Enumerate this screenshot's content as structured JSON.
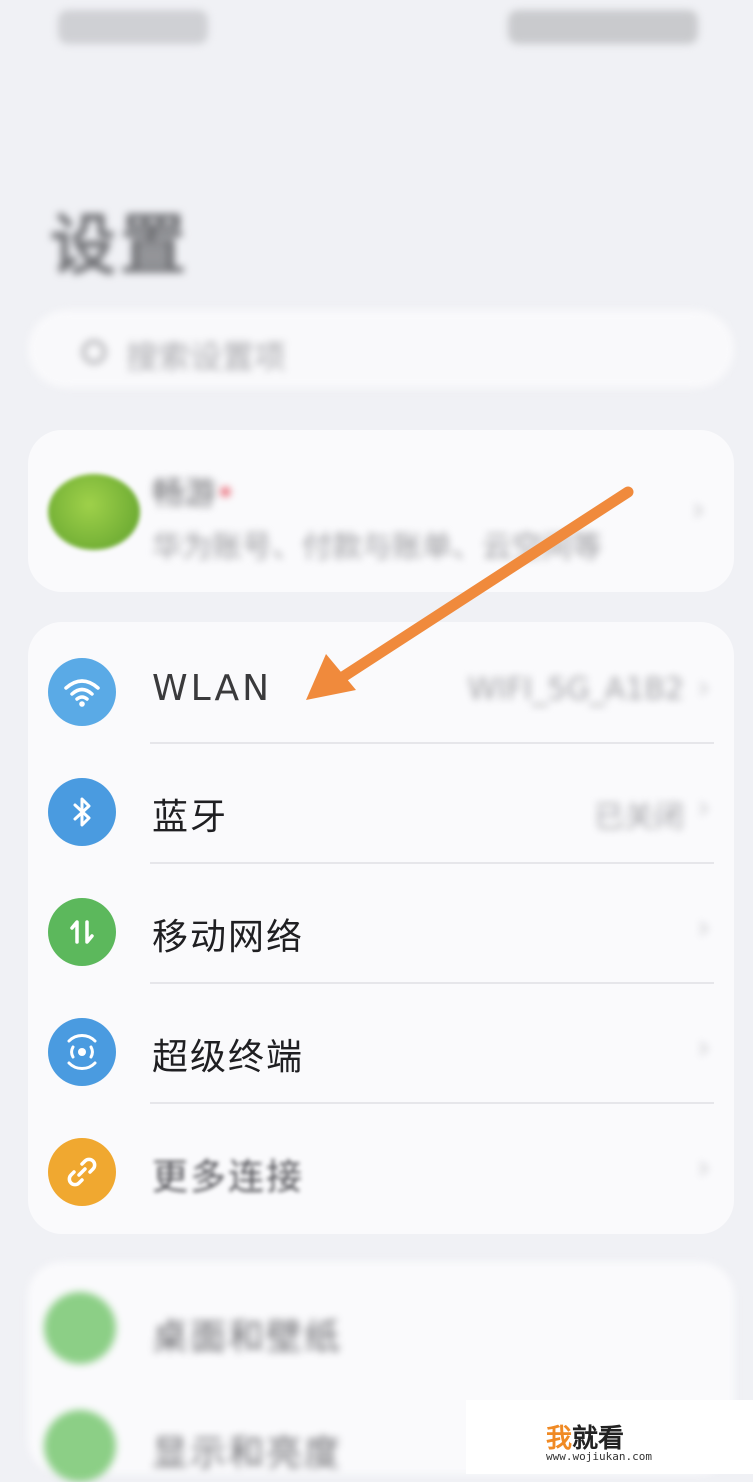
{
  "page_title": "设置",
  "search": {
    "placeholder": "搜索设置项"
  },
  "account": {
    "name": "畅游",
    "name_badge": "•",
    "subtitle": "华为账号、付款与账单、云空间等"
  },
  "connect_items": [
    {
      "label": "WLAN",
      "value": "WIFI_5G_A1B2",
      "icon": "wifi-icon",
      "color": "#5aaae6"
    },
    {
      "label": "蓝牙",
      "value": "已关闭",
      "icon": "bluetooth-icon",
      "color": "#4a9be0"
    },
    {
      "label": "移动网络",
      "value": "",
      "icon": "mobile-network-icon",
      "color": "#5cb85c"
    },
    {
      "label": "超级终端",
      "value": "",
      "icon": "super-device-icon",
      "color": "#4a9be0"
    },
    {
      "label": "更多连接",
      "value": "",
      "icon": "link-icon",
      "color": "#f0a830"
    }
  ],
  "display_items": [
    {
      "label": "桌面和壁纸",
      "icon": "wallpaper-icon"
    },
    {
      "label": "显示和亮度",
      "icon": "display-icon"
    }
  ],
  "chevron": "›",
  "annotation": {
    "color": "#f08a3c"
  },
  "watermark": {
    "logo_first": "我",
    "logo_rest": "就看",
    "url": "www.wojiukan.com"
  }
}
